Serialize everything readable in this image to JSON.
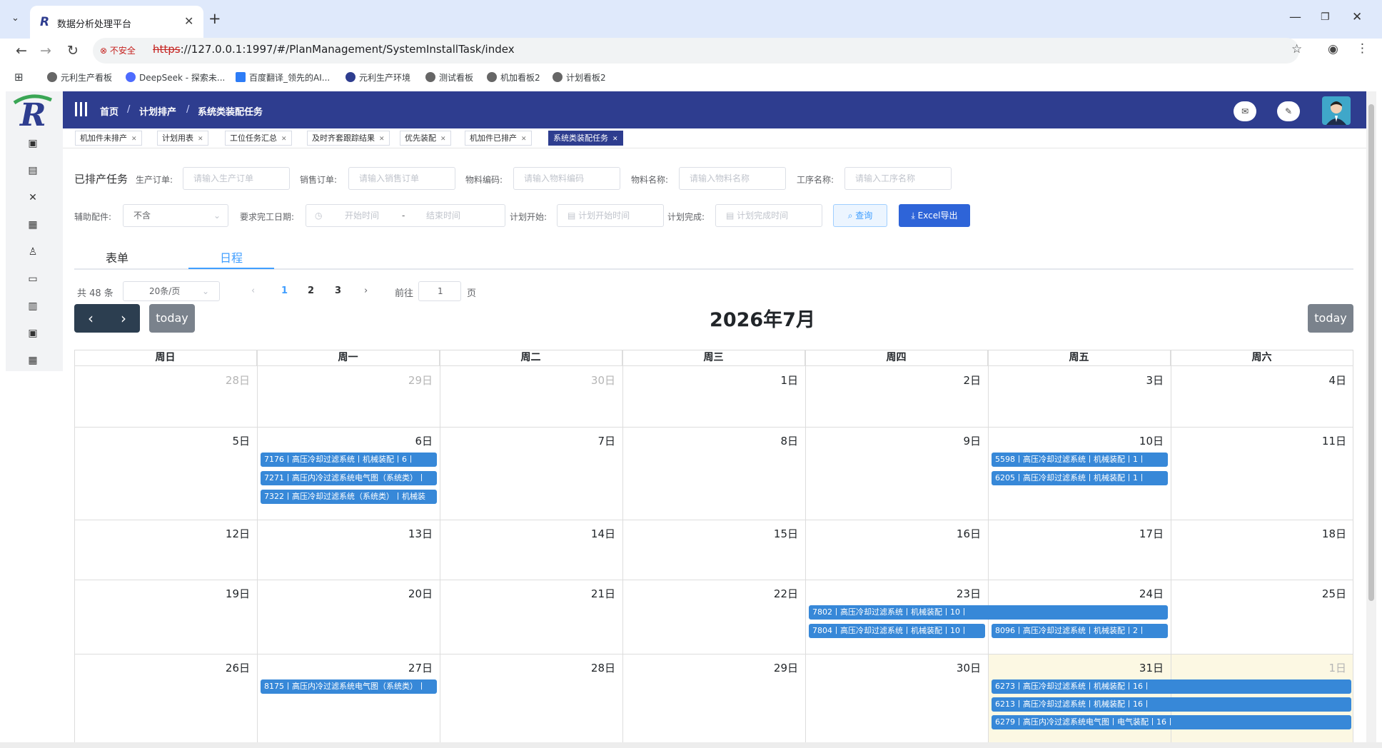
{
  "browser": {
    "tab_title": "数据分析处理平台",
    "insecure_label": "不安全",
    "url_scheme": "https",
    "url_rest": "://127.0.0.1:1997/#/PlanManagement/SystemInstallTask/index",
    "bookmarks": [
      "元利生产看板",
      "DeepSeek - 探索未...",
      "百度翻译_领先的AI...",
      "元利生产环境",
      "测试看板",
      "机加看板2",
      "计划看板2"
    ]
  },
  "header": {
    "breadcrumb": [
      "首页",
      "计划排产",
      "系统类装配任务"
    ],
    "separator": "/"
  },
  "tags": [
    {
      "label": "机加件未排产",
      "active": false
    },
    {
      "label": "计划用表",
      "active": false
    },
    {
      "label": "工位任务汇总",
      "active": false
    },
    {
      "label": "及时齐套跟踪结果",
      "active": false
    },
    {
      "label": "优先装配",
      "active": false
    },
    {
      "label": "机加件已排产",
      "active": false
    },
    {
      "label": "系统类装配任务",
      "active": true
    }
  ],
  "filters": {
    "section_title": "已排产任务",
    "production_order_label": "生产订单:",
    "production_order_ph": "请输入生产订单",
    "sales_order_label": "销售订单:",
    "sales_order_ph": "请输入销售订单",
    "material_code_label": "物料编码:",
    "material_code_ph": "请输入物料编码",
    "material_name_label": "物料名称:",
    "material_name_ph": "请输入物料名称",
    "process_name_label": "工序名称:",
    "process_name_ph": "请输入工序名称",
    "aux_label": "辅助配件:",
    "aux_value": "不含",
    "due_label": "要求完工日期:",
    "due_start_ph": "开始时间",
    "due_sep": "-",
    "due_end_ph": "结束时间",
    "plan_start_label": "计划开始:",
    "plan_start_ph": "计划开始时间",
    "plan_end_label": "计划完成:",
    "plan_end_ph": "计划完成时间",
    "query_label": "查询",
    "export_label": "Excel导出"
  },
  "view_tabs": {
    "form": "表单",
    "schedule": "日程"
  },
  "pagination": {
    "total": "共 48 条",
    "page_size": "20条/页",
    "pages": [
      "1",
      "2",
      "3"
    ],
    "current": "1",
    "goto_label": "前往",
    "goto_value": "1",
    "page_label": "页"
  },
  "calendar": {
    "title": "2026年7月",
    "today_label": "today",
    "weekdays": [
      "周日",
      "周一",
      "周二",
      "周三",
      "周四",
      "周五",
      "周六"
    ],
    "weeks": [
      [
        "28日",
        "29日",
        "30日",
        "1日",
        "2日",
        "3日",
        "4日"
      ],
      [
        "5日",
        "6日",
        "7日",
        "8日",
        "9日",
        "10日",
        "11日"
      ],
      [
        "12日",
        "13日",
        "14日",
        "15日",
        "16日",
        "17日",
        "18日"
      ],
      [
        "19日",
        "20日",
        "21日",
        "22日",
        "23日",
        "24日",
        "25日"
      ],
      [
        "26日",
        "27日",
        "28日",
        "29日",
        "30日",
        "31日",
        "1日"
      ]
    ],
    "events": [
      "7176丨高压冷却过滤系统丨机械装配丨6丨",
      "7271丨高压内冷过滤系统电气图（系统类）丨",
      "7322丨高压冷却过滤系统（系统类）丨机械装",
      "5598丨高压冷却过滤系统丨机械装配丨1丨",
      "6205丨高压冷却过滤系统丨机械装配丨1丨",
      "7802丨高压冷却过滤系统丨机械装配丨10丨",
      "7804丨高压冷却过滤系统丨机械装配丨10丨",
      "8096丨高压冷却过滤系统丨机械装配丨2丨",
      "8175丨高压内冷过滤系统电气图（系统类）丨",
      "6273丨高压冷却过滤系统丨机械装配丨16丨",
      "6213丨高压冷却过滤系统丨机械装配丨16丨",
      "6279丨高压内冷过滤系统电气图丨电气装配丨16丨"
    ]
  },
  "colors": {
    "header": "#2e3d8f",
    "event": "#3788d8",
    "today": "#fcf8e3",
    "link": "#409eff"
  }
}
